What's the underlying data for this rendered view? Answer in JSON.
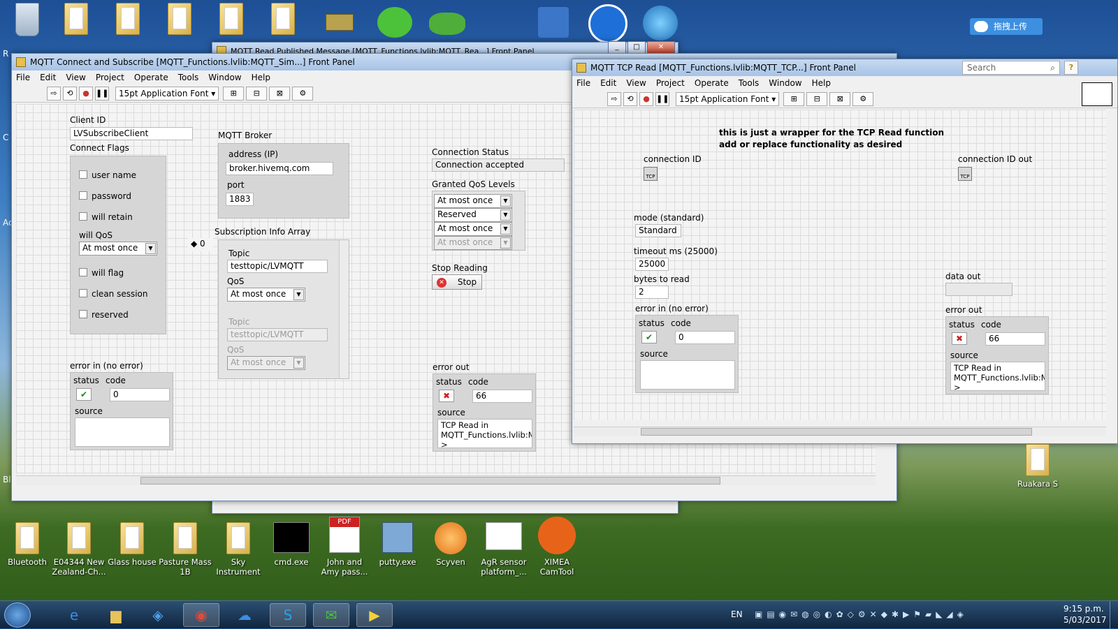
{
  "desktop": {
    "top_icons": [
      "Recycle Bin",
      "",
      "",
      "",
      "",
      "",
      "",
      "",
      "",
      "",
      "",
      ""
    ],
    "left_labels": [
      "R",
      "C",
      "Ac",
      "Bl"
    ],
    "top_right_button": "拖拽上传",
    "bottom_icons": [
      {
        "label": "Bluetooth"
      },
      {
        "label": "E04344 New Zealand-Ch..."
      },
      {
        "label": "Glass house"
      },
      {
        "label": "Pasture Mass 1B"
      },
      {
        "label": "Sky Instrument"
      },
      {
        "label": "cmd.exe"
      },
      {
        "label": "John and Amy pass..."
      },
      {
        "label": "putty.exe"
      },
      {
        "label": "Scyven"
      },
      {
        "label": "AgR sensor platform_..."
      },
      {
        "label": "XIMEA CamTool"
      }
    ],
    "right_icon": "Ruakara S",
    "pdf_badge": "PDF"
  },
  "back_window": {
    "title": "MQTT Read Published Message [MQTT_Functions.lvlib:MQTT_Rea...] Front Panel"
  },
  "main_window": {
    "title": "MQTT Connect and Subscribe [MQTT_Functions.lvlib:MQTT_Sim...] Front Panel",
    "menu": [
      "File",
      "Edit",
      "View",
      "Project",
      "Operate",
      "Tools",
      "Window",
      "Help"
    ],
    "font": "15pt Application Font",
    "client_id_label": "Client ID",
    "client_id_value": "LVSubscribeClient",
    "connect_flags_label": "Connect Flags",
    "flags": {
      "user_name": "user name",
      "password": "password",
      "will_retain": "will retain",
      "will_qos": "will QoS",
      "will_qos_value": "At most once",
      "will_flag": "will flag",
      "clean_session": "clean session",
      "reserved": "reserved"
    },
    "broker_label": "MQTT Broker",
    "address_label": "address (IP)",
    "address_value": "broker.hivemq.com",
    "port_label": "port",
    "port_value": "1883",
    "sub_label": "Subscription Info Array",
    "sub_index": "0",
    "topic_label": "Topic",
    "topic_value": "testtopic/LVMQTT",
    "qos_label": "QoS",
    "qos_value": "At most once",
    "conn_status_label": "Connection Status",
    "conn_status_value": "Connection accepted",
    "granted_label": "Granted QoS Levels",
    "granted": [
      "At most once",
      "Reserved",
      "At most once",
      "At most once"
    ],
    "stop_label": "Stop Reading",
    "stop_button": "Stop",
    "error_in_label": "error in (no error)",
    "error_out_label": "error out",
    "status_label": "status",
    "code_label": "code",
    "source_label": "source",
    "error_in_code": "0",
    "error_out_code": "66",
    "error_out_source": "TCP Read in MQTT_Functions.lvlib:MQTT_TCP_Read.vi->"
  },
  "tcp_window": {
    "title": "MQTT TCP Read [MQTT_Functions.lvlib:MQTT_TCP...] Front Panel",
    "menu": [
      "File",
      "Edit",
      "View",
      "Project",
      "Operate",
      "Tools",
      "Window",
      "Help"
    ],
    "font": "15pt Application Font",
    "search_placeholder": "Search",
    "note_line1": "this is just a wrapper for the TCP Read function",
    "note_line2": "add or replace functionality as desired",
    "conn_id_label": "connection ID",
    "conn_id_out_label": "connection ID out",
    "tcp_tag": "TCP",
    "mode_label": "mode (standard)",
    "mode_value": "Standard",
    "timeout_label": "timeout ms (25000)",
    "timeout_value": "25000",
    "bytes_label": "bytes to read",
    "bytes_value": "2",
    "data_out_label": "data out",
    "error_in_label": "error in (no error)",
    "error_out_label": "error out",
    "status_label": "status",
    "code_label": "code",
    "source_label": "source",
    "error_in_code": "0",
    "error_out_code": "66",
    "error_out_source": "TCP Read in MQTT_Functions.lvlib:MQTT_TCP_Read.vi->"
  },
  "taskbar": {
    "lang": "EN",
    "time": "9:15 p.m.",
    "date": "5/03/2017"
  }
}
